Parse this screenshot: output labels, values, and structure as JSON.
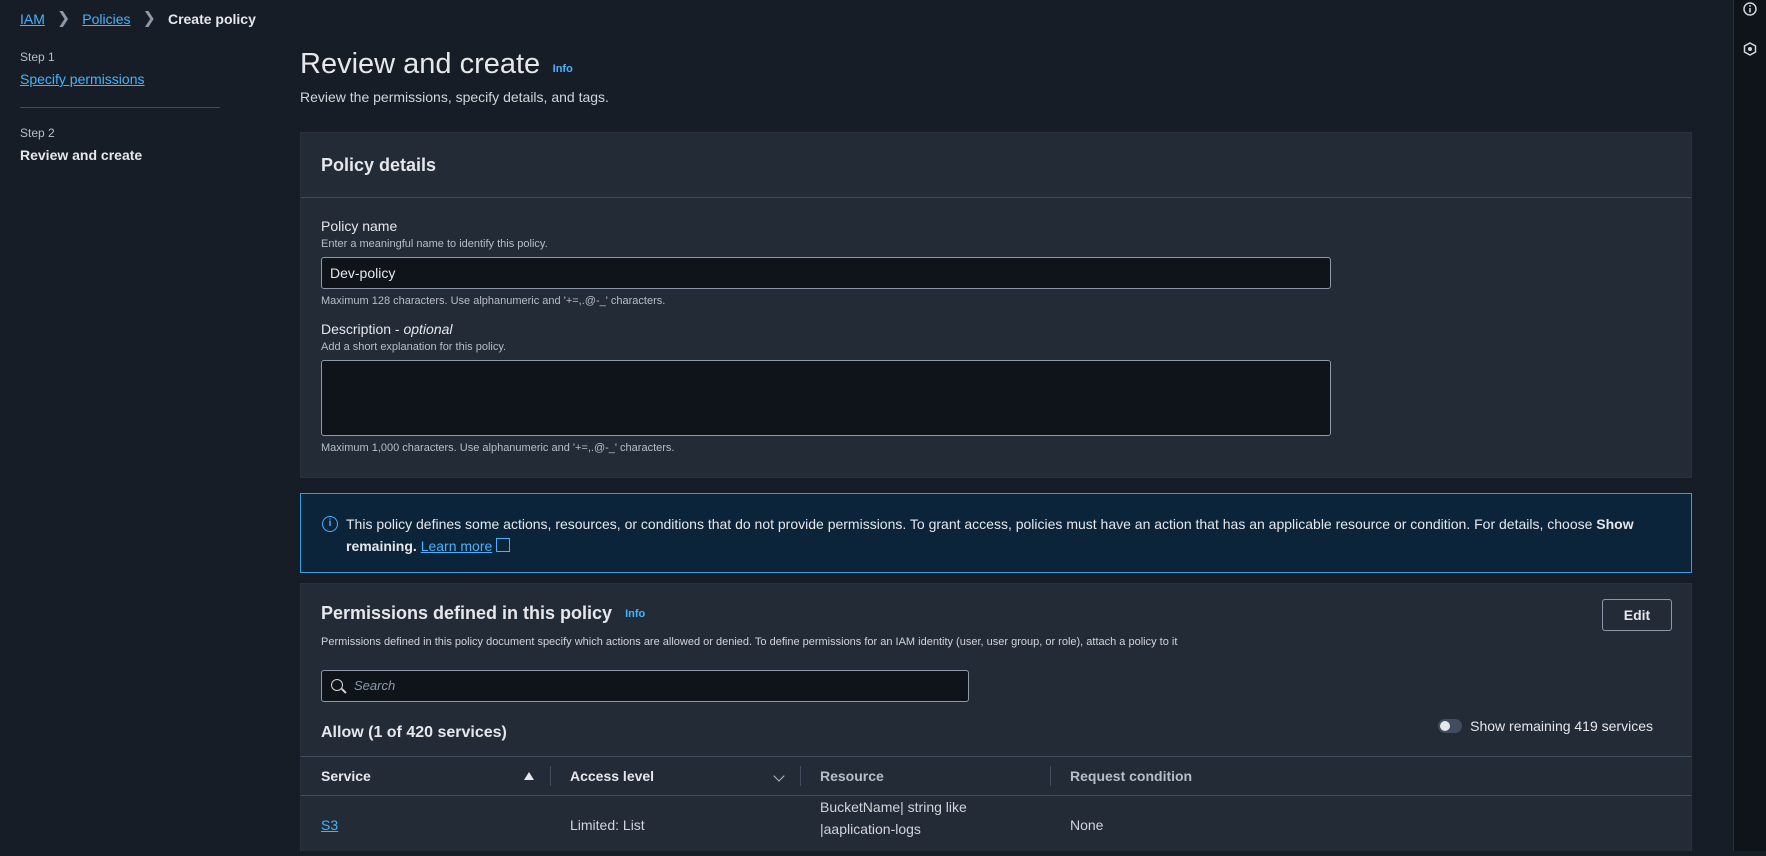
{
  "breadcrumb": {
    "items": [
      "IAM",
      "Policies"
    ],
    "current": "Create policy"
  },
  "steps": [
    {
      "label": "Step 1",
      "title": "Specify permissions"
    },
    {
      "label": "Step 2",
      "title": "Review and create"
    }
  ],
  "page": {
    "title": "Review and create",
    "info": "Info",
    "description": "Review the permissions, specify details, and tags."
  },
  "policy_details": {
    "heading": "Policy details",
    "name_label": "Policy name",
    "name_desc": "Enter a meaningful name to identify this policy.",
    "name_value": "Dev-policy",
    "name_constraint": "Maximum 128 characters. Use alphanumeric and '+=,.@-_' characters.",
    "desc_label": "Description - ",
    "desc_label_optional": "optional",
    "desc_desc": "Add a short explanation for this policy.",
    "desc_value": "",
    "desc_constraint": "Maximum 1,000 characters. Use alphanumeric and '+=,.@-_' characters."
  },
  "alert": {
    "text": "This policy defines some actions, resources, or conditions that do not provide permissions. To grant access, policies must have an action that has an applicable resource or condition. For details, choose ",
    "bold": "Show remaining.",
    "link": "Learn more"
  },
  "permissions": {
    "title": "Permissions defined in this policy",
    "info": "Info",
    "description": "Permissions defined in this policy document specify which actions are allowed or denied. To define permissions for an IAM identity (user, user group, or role), attach a policy to it",
    "edit_label": "Edit",
    "search_placeholder": "Search",
    "allow_title": "Allow (1 of 420 services)",
    "toggle_label": "Show remaining 419 services",
    "columns": [
      "Service",
      "Access level",
      "Resource",
      "Request condition"
    ],
    "rows": [
      {
        "service": "S3",
        "access": "Limited: List",
        "resource_line1": "BucketName| string like",
        "resource_line2": "|aaplication-logs",
        "condition": "None"
      }
    ]
  }
}
